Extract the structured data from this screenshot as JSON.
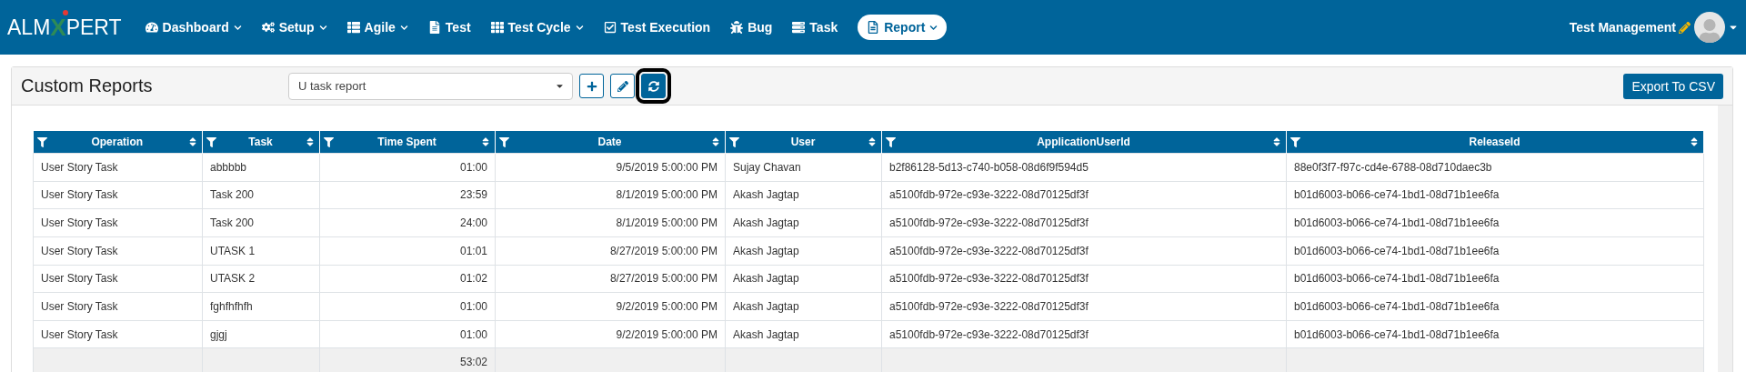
{
  "brand": {
    "logo_parts": [
      "ALM",
      "X",
      "PERT"
    ]
  },
  "nav": [
    {
      "kind": "dashboard",
      "label": "Dashboard",
      "dropdown": true,
      "selected": false
    },
    {
      "kind": "setup",
      "label": "Setup",
      "dropdown": true,
      "selected": false
    },
    {
      "kind": "agile",
      "label": "Agile",
      "dropdown": true,
      "selected": false
    },
    {
      "kind": "test",
      "label": "Test",
      "dropdown": false,
      "selected": false
    },
    {
      "kind": "cycle",
      "label": "Test Cycle",
      "dropdown": true,
      "selected": false
    },
    {
      "kind": "execution",
      "label": "Test Execution",
      "dropdown": false,
      "selected": false
    },
    {
      "kind": "bug",
      "label": "Bug",
      "dropdown": false,
      "selected": false
    },
    {
      "kind": "task",
      "label": "Task",
      "dropdown": false,
      "selected": false
    },
    {
      "kind": "report",
      "label": "Report",
      "dropdown": true,
      "selected": true
    }
  ],
  "user": {
    "name": "Test Management"
  },
  "panel": {
    "title": "Custom Reports",
    "report_select": {
      "value": "U task report"
    },
    "tools": [
      {
        "kind": "add",
        "active": false
      },
      {
        "kind": "edit",
        "active": false
      },
      {
        "kind": "refresh",
        "active": true
      }
    ],
    "export_button": "Export To CSV"
  },
  "table": {
    "columns": [
      {
        "label": "Operation",
        "kind": "text"
      },
      {
        "label": "Task",
        "kind": "text"
      },
      {
        "label": "Time Spent",
        "kind": "number",
        "total": "53:02"
      },
      {
        "label": "Date",
        "kind": "number"
      },
      {
        "label": "User",
        "kind": "text"
      },
      {
        "label": "ApplicationUserId",
        "kind": "text"
      },
      {
        "label": "ReleaseId",
        "kind": "text"
      }
    ],
    "rows": [
      [
        "User Story Task",
        "abbbbb",
        "01:00",
        "9/5/2019 5:00:00 PM",
        "Sujay Chavan",
        "b2f86128-5d13-c740-b058-08d6f9f594d5",
        "88e0f3f7-f97c-cd4e-6788-08d710daec3b"
      ],
      [
        "User Story Task",
        "Task 200",
        "23:59",
        "8/1/2019 5:00:00 PM",
        "Akash Jagtap",
        "a5100fdb-972e-c93e-3222-08d70125df3f",
        "b01d6003-b066-ce74-1bd1-08d71b1ee6fa"
      ],
      [
        "User Story Task",
        "Task 200",
        "24:00",
        "8/1/2019 5:00:00 PM",
        "Akash Jagtap",
        "a5100fdb-972e-c93e-3222-08d70125df3f",
        "b01d6003-b066-ce74-1bd1-08d71b1ee6fa"
      ],
      [
        "User Story Task",
        "UTASK 1",
        "01:01",
        "8/27/2019 5:00:00 PM",
        "Akash Jagtap",
        "a5100fdb-972e-c93e-3222-08d70125df3f",
        "b01d6003-b066-ce74-1bd1-08d71b1ee6fa"
      ],
      [
        "User Story Task",
        "UTASK 2",
        "01:02",
        "8/27/2019 5:00:00 PM",
        "Akash Jagtap",
        "a5100fdb-972e-c93e-3222-08d70125df3f",
        "b01d6003-b066-ce74-1bd1-08d71b1ee6fa"
      ],
      [
        "User Story Task",
        "fghfhfhfh",
        "01:00",
        "9/2/2019 5:00:00 PM",
        "Akash Jagtap",
        "a5100fdb-972e-c93e-3222-08d70125df3f",
        "b01d6003-b066-ce74-1bd1-08d71b1ee6fa"
      ],
      [
        "User Story Task",
        "gjgj",
        "01:00",
        "9/2/2019 5:00:00 PM",
        "Akash Jagtap",
        "a5100fdb-972e-c93e-3222-08d70125df3f",
        "b01d6003-b066-ce74-1bd1-08d71b1ee6fa"
      ]
    ]
  }
}
